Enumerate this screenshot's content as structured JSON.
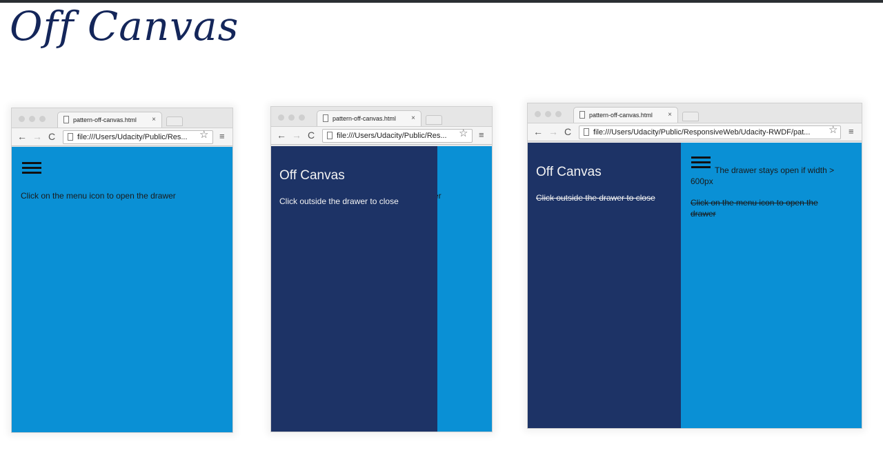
{
  "page_title": "Off Canvas",
  "browser": {
    "tab_title": "pattern-off-canvas.html",
    "tab_close": "×",
    "back_icon": "←",
    "forward_icon": "→",
    "reload_icon": "C",
    "star_icon": "☆",
    "menu_icon": "≡"
  },
  "panels": [
    {
      "url": "file:///Users/Udacity/Public/Res...",
      "main_text": "Click on the menu icon to open the drawer"
    },
    {
      "url": "file:///Users/Udacity/Public/Res...",
      "drawer_title": "Off Canvas",
      "drawer_text": "Click outside the drawer to close",
      "peek_text": "er"
    },
    {
      "url": "file:///Users/Udacity/Public/ResponsiveWeb/Udacity-RWDF/pat...",
      "drawer_title": "Off Canvas",
      "drawer_text": "Click outside the drawer to close",
      "main_text_1": "The drawer stays open if width > 600px",
      "main_text_2": "Click on the menu icon to open the drawer"
    }
  ],
  "colors": {
    "main_blue": "#0a90d5",
    "drawer_navy": "#1d3366",
    "title_ink": "#14265a"
  }
}
